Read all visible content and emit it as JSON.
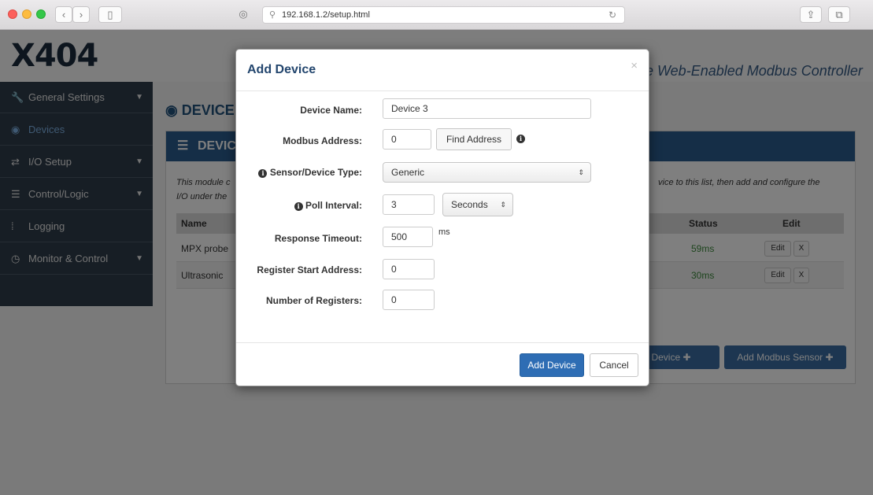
{
  "browser": {
    "url": "192.168.1.2/setup.html"
  },
  "header": {
    "logo": "X404",
    "tagline": "e Web-Enabled Modbus Controller"
  },
  "sidebar": {
    "items": [
      {
        "label": "General Settings",
        "icon": "wrench-icon"
      },
      {
        "label": "Devices",
        "icon": "globe-icon"
      },
      {
        "label": "I/O Setup",
        "icon": "arrows-icon"
      },
      {
        "label": "Control/Logic",
        "icon": "server-icon"
      },
      {
        "label": "Logging",
        "icon": "bars-icon"
      },
      {
        "label": "Monitor & Control",
        "icon": "dashboard-icon"
      }
    ]
  },
  "main": {
    "title": "DEVICE",
    "panel_title": "DEVIC",
    "description_left": "This module c",
    "description_left2": "I/O under the",
    "description_right": "vice to this list, then add and configure the",
    "table": {
      "headers": {
        "name": "Name",
        "status": "Status",
        "edit": "Edit"
      },
      "rows": [
        {
          "name": "MPX probe",
          "status": "59ms",
          "edit": "Edit",
          "remove": "X"
        },
        {
          "name": "Ultrasonic",
          "status": "30ms",
          "edit": "Edit",
          "remove": "X"
        }
      ]
    },
    "add_ethernet_label": "net Device",
    "add_modbus_label": "Add Modbus Sensor"
  },
  "modal": {
    "title": "Add Device",
    "close": "×",
    "fields": {
      "device_name": {
        "label": "Device Name:",
        "value": "Device 3"
      },
      "modbus_address": {
        "label": "Modbus Address:",
        "value": "0",
        "button": "Find Address"
      },
      "sensor_type": {
        "label": "Sensor/Device Type:",
        "value": "Generic"
      },
      "poll_interval": {
        "label": "Poll Interval:",
        "value": "3",
        "unit": "Seconds"
      },
      "response_timeout": {
        "label": "Response Timeout:",
        "value": "500",
        "unit": "ms"
      },
      "register_start": {
        "label": "Register Start Address:",
        "value": "0"
      },
      "num_registers": {
        "label": "Number of Registers:",
        "value": "0"
      }
    },
    "submit_label": "Add Device",
    "cancel_label": "Cancel"
  }
}
